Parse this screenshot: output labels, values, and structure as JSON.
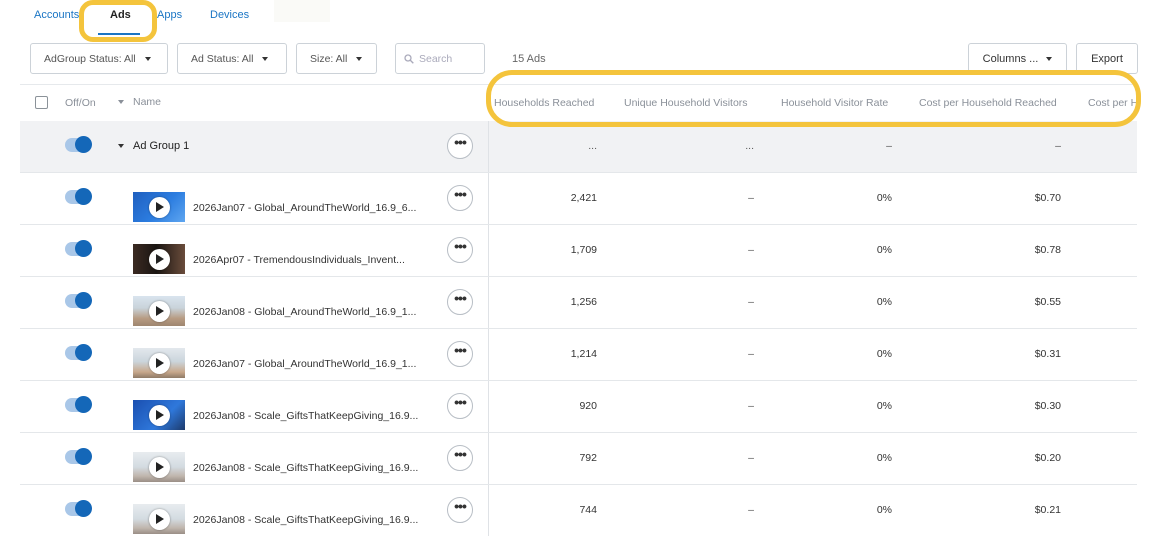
{
  "tabs": {
    "accounts": "Accounts",
    "ads": "Ads",
    "apps": "Apps",
    "devices": "Devices"
  },
  "filters": {
    "adgroup_status": "AdGroup Status: All",
    "ad_status": "Ad Status: All",
    "size": "Size: All"
  },
  "search": {
    "placeholder": "Search"
  },
  "ad_count": "15 Ads",
  "buttons": {
    "columns": "Columns ...",
    "export": "Export"
  },
  "columns": {
    "toggle": "Off/On",
    "name": "Name",
    "households_reached": "Households Reached",
    "unique_household_visitors": "Unique Household Visitors",
    "household_visitor_rate": "Household Visitor Rate",
    "cost_per_household_reached": "Cost per Household Reached",
    "cost_per_partial": "Cost per H"
  },
  "group": {
    "name": "Ad Group 1",
    "households_reached": "...",
    "unique_household_visitors": "...",
    "household_visitor_rate": "–",
    "cost_per_household_reached": "–"
  },
  "more_label": "•••",
  "ads": [
    {
      "name": "2026Jan07 - Global_AroundTheWorld_16.9_6...",
      "households_reached": "2,421",
      "unique_household_visitors": "–",
      "household_visitor_rate": "0%",
      "cost_per_household_reached": "$0.70",
      "enabled": true,
      "thumb": "blue"
    },
    {
      "name": "2026Apr07 - TremendousIndividuals_Invent...",
      "households_reached": "1,709",
      "unique_household_visitors": "–",
      "household_visitor_rate": "0%",
      "cost_per_household_reached": "$0.78",
      "enabled": true,
      "thumb": "dark"
    },
    {
      "name": "2026Jan08 - Global_AroundTheWorld_16.9_1...",
      "households_reached": "1,256",
      "unique_household_visitors": "–",
      "household_visitor_rate": "0%",
      "cost_per_household_reached": "$0.55",
      "enabled": true,
      "thumb": "photo"
    },
    {
      "name": "2026Jan07 - Global_AroundTheWorld_16.9_1...",
      "households_reached": "1,214",
      "unique_household_visitors": "–",
      "household_visitor_rate": "0%",
      "cost_per_household_reached": "$0.31",
      "enabled": true,
      "thumb": "photo2"
    },
    {
      "name": "2026Jan08 - Scale_GiftsThatKeepGiving_16.9...",
      "households_reached": "920",
      "unique_household_visitors": "–",
      "household_visitor_rate": "0%",
      "cost_per_household_reached": "$0.30",
      "enabled": true,
      "thumb": "blue2"
    },
    {
      "name": "2026Jan08 - Scale_GiftsThatKeepGiving_16.9...",
      "households_reached": "792",
      "unique_household_visitors": "–",
      "household_visitor_rate": "0%",
      "cost_per_household_reached": "$0.20",
      "enabled": true,
      "thumb": "gift"
    },
    {
      "name": "2026Jan08 - Scale_GiftsThatKeepGiving_16.9...",
      "households_reached": "744",
      "unique_household_visitors": "–",
      "household_visitor_rate": "0%",
      "cost_per_household_reached": "$0.21",
      "enabled": true,
      "thumb": "gift"
    }
  ],
  "colors": {
    "accent": "#1a75c4",
    "toggle_on": "#1467b8",
    "highlight": "#f4c43c"
  }
}
